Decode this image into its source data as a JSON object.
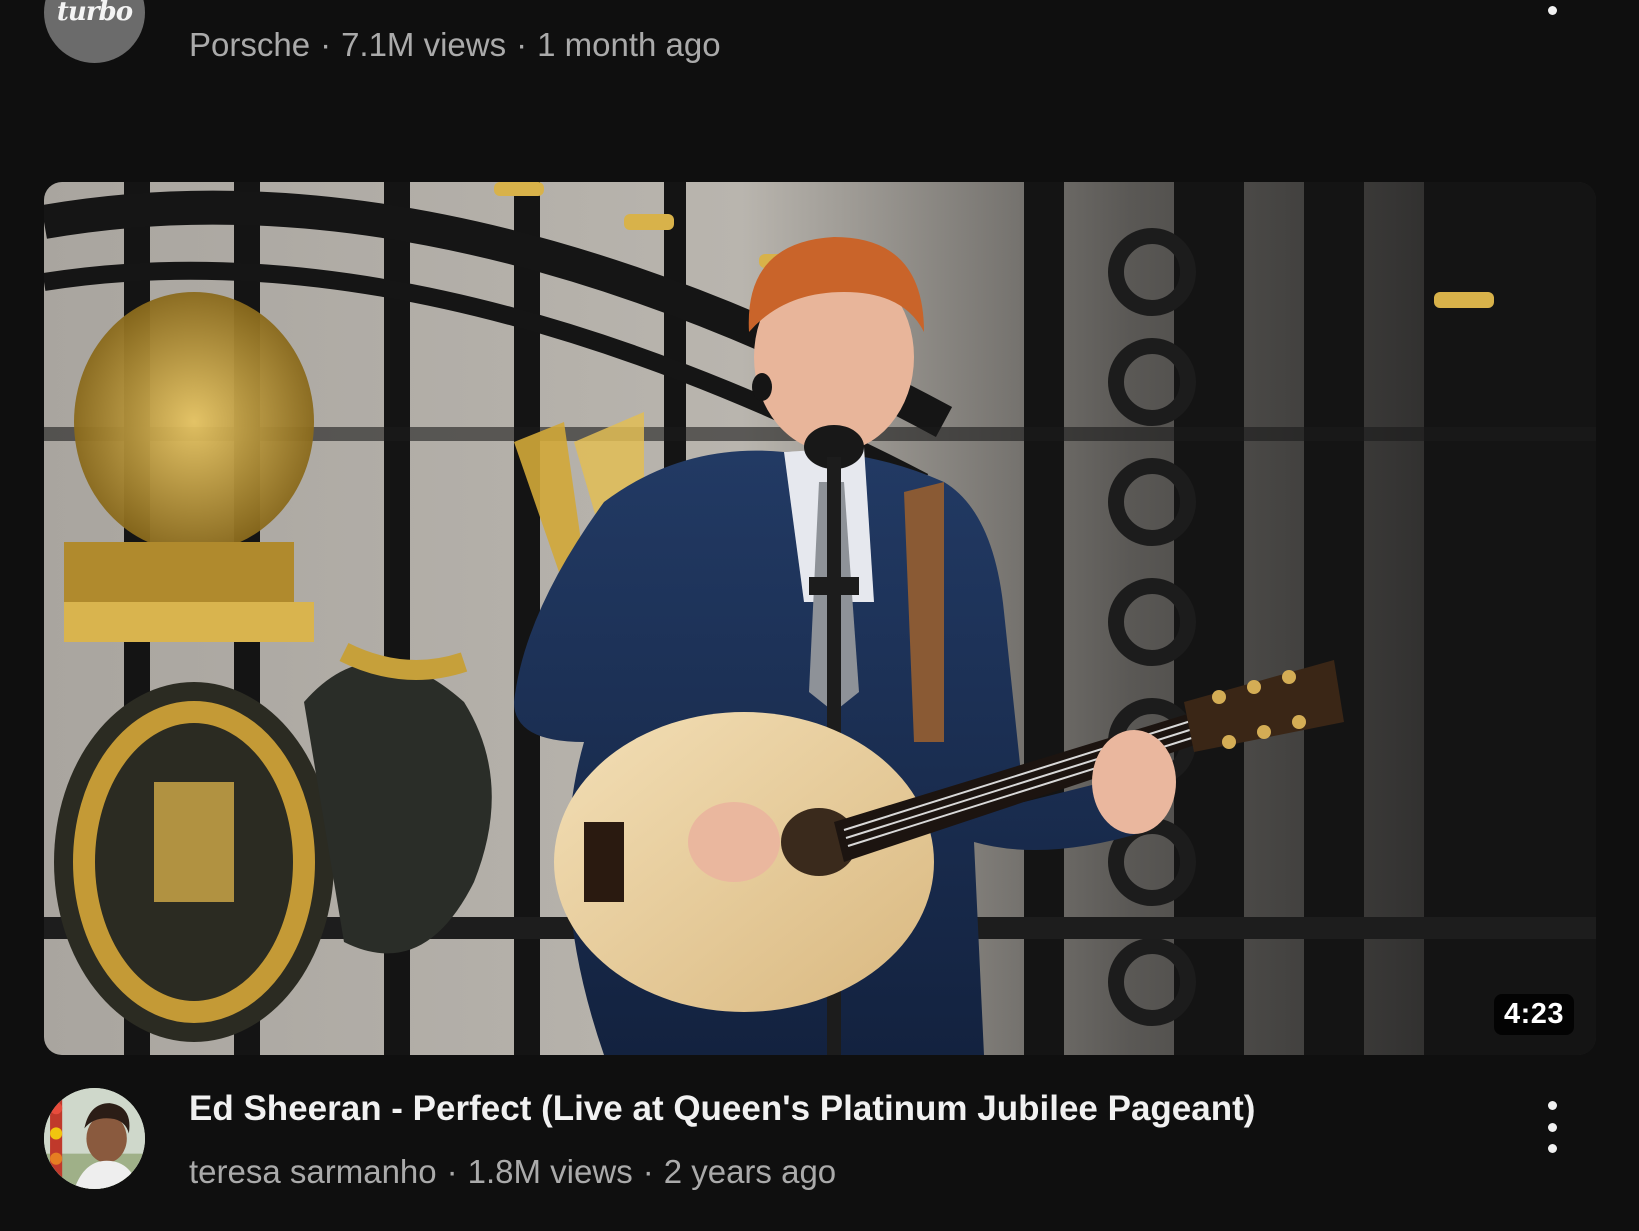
{
  "previous_video": {
    "channel_avatar_text": "turbo",
    "channel": "Porsche",
    "views": "7.1M views",
    "age": "1 month ago"
  },
  "video": {
    "title": "Ed Sheeran - Perfect (Live at Queen's Platinum Jubilee Pageant)",
    "duration": "4:23",
    "channel": "teresa sarmanho",
    "views": "1.8M views",
    "age": "2 years ago"
  },
  "separator": "·",
  "icons": {
    "previous_menu": "more-vertical-icon",
    "video_menu": "more-vertical-icon"
  },
  "colors": {
    "background": "#0f0f0f",
    "primary_text": "#f1f1f1",
    "secondary_text": "#aaaaaa"
  }
}
